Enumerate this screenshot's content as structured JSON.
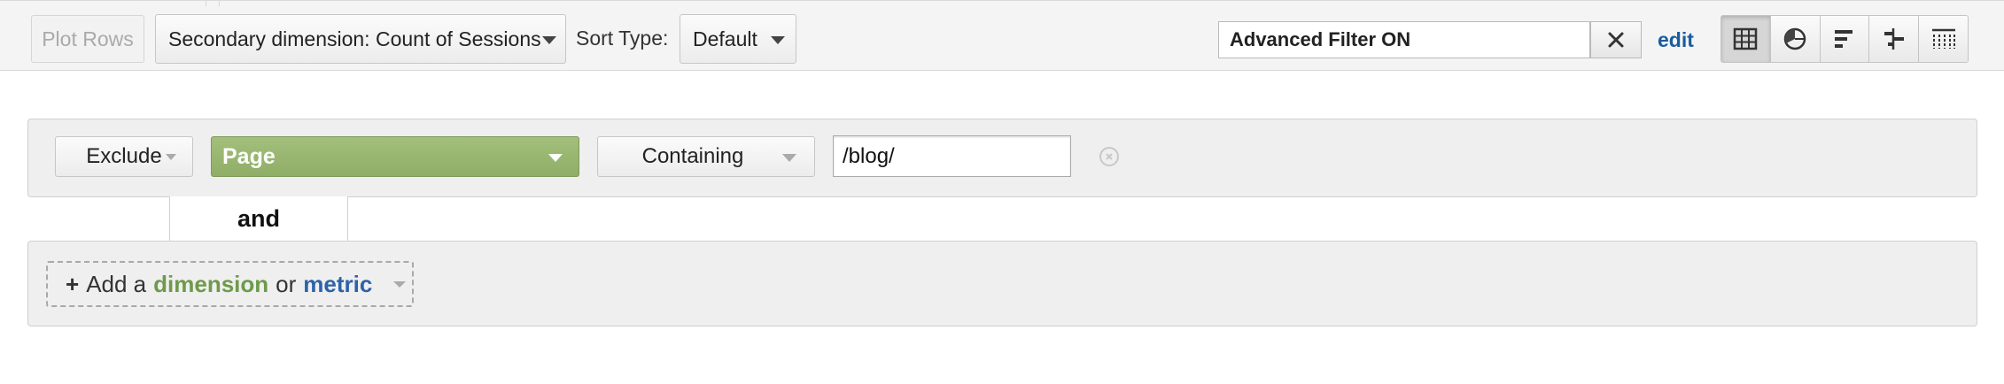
{
  "toolbar": {
    "plot_rows_label": "Plot Rows",
    "secondary_dimension_label": "Secondary dimension: Count of Sessions",
    "sort_type_label": "Sort Type:",
    "sort_type_value": "Default",
    "advanced_filter_text": "Advanced Filter ON",
    "edit_label": "edit",
    "views": [
      {
        "icon": "table-icon",
        "active": true
      },
      {
        "icon": "pie-chart-icon",
        "active": false
      },
      {
        "icon": "bar-chart-icon",
        "active": false
      },
      {
        "icon": "comparison-icon",
        "active": false
      },
      {
        "icon": "pivot-icon",
        "active": false
      }
    ]
  },
  "filter": {
    "condition": {
      "mode": "Exclude",
      "dimension": "Page",
      "match_type": "Containing",
      "value": "/blog/"
    },
    "join_label": "and",
    "add": {
      "plus": "+",
      "prefix": "Add a",
      "dimension_word": "dimension",
      "or_word": "or",
      "metric_word": "metric"
    }
  },
  "colors": {
    "dimension_green": "#8fae66",
    "metric_blue": "#2e62a8",
    "link_blue": "#1a5c9e"
  }
}
